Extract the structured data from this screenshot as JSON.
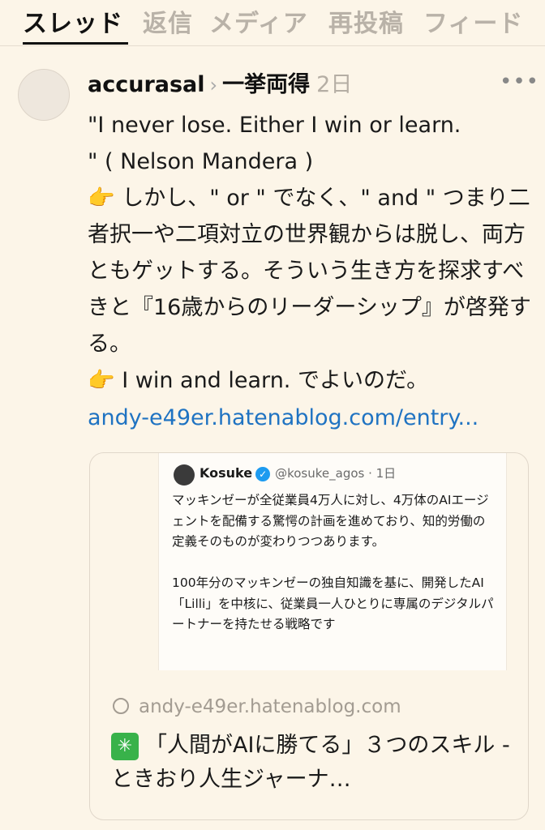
{
  "tabs": [
    {
      "label": "スレッド",
      "active": true
    },
    {
      "label": "返信"
    },
    {
      "label": "メディア"
    },
    {
      "label": "再投稿"
    },
    {
      "label": "フィード"
    }
  ],
  "post": {
    "username": "accurasal",
    "chevron": "›",
    "topic": "一挙両得",
    "age": "2日",
    "more": "•••",
    "body": "\"I never lose. Either I win or learn.\n\" ( Nelson Mandera )\n👉 しかし、\" or \" でなく、\" and \" つまり二者択一や二項対立の世界観からは脱し、両方ともゲットする。そういう生き方を探求すべきと『16歳からのリーダーシップ』が啓発する。\n👉 I win and learn. でよいのだ。",
    "link": "andy-e49er.hatenablog.com/entry..."
  },
  "card": {
    "shot": {
      "name": "Kosuke",
      "verified": "✓",
      "handle": "@kosuke_agos · 1日",
      "text": "マッキンゼーが全従業員4万人に対し、4万体のAIエージェントを配備する驚愕の計画を進めており、知的労働の定義そのものが変わりつつあります。\n\n100年分のマッキンゼーの独自知識を基に、開発したAI「Lilli」を中核に、従業員一人ひとりに専属のデジタルパートナーを持たせる戦略です"
    },
    "domain": "andy-e49er.hatenablog.com",
    "icon": "✳",
    "title": "「人間がAIに勝てる」３つのスキル - ときおり人生ジャーナ…"
  }
}
